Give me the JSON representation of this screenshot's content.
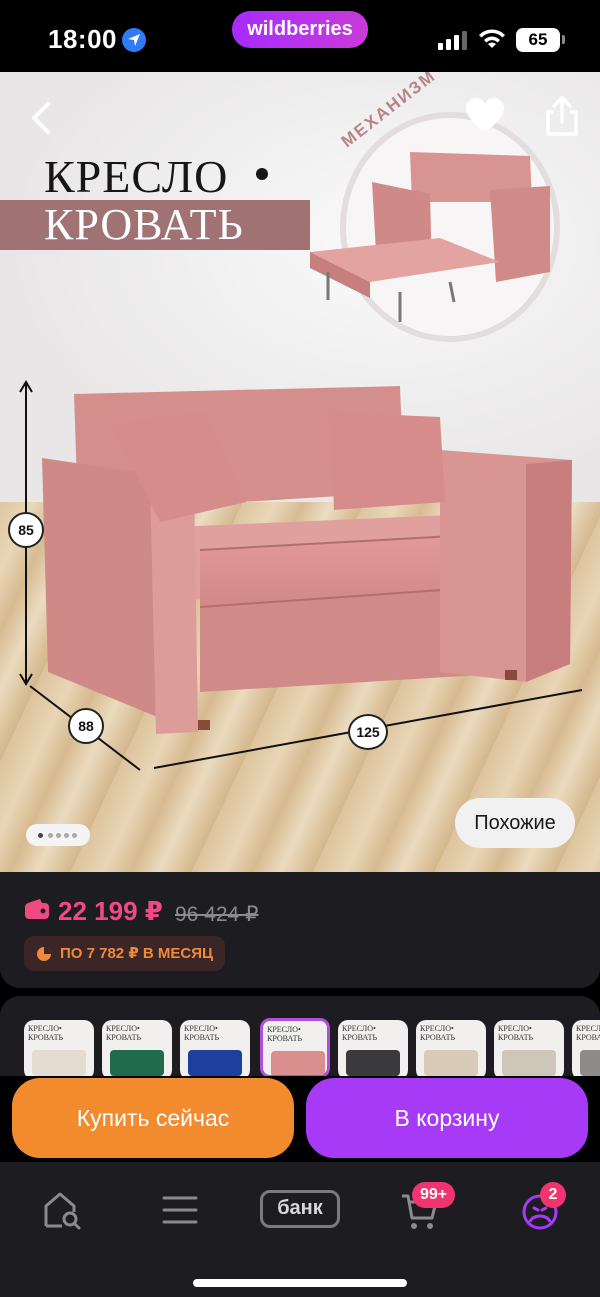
{
  "status_bar": {
    "time": "18:00",
    "brand": "wildberries",
    "battery": "65"
  },
  "gallery": {
    "promo_line1": "КРЕСЛО",
    "promo_line2": "КРОВАТЬ",
    "mechanism_label": "МЕХАНИЗМ «ЮНИОР»",
    "dimensions": {
      "height": "85",
      "depth": "88",
      "width": "125"
    },
    "similar_button": "Похожие",
    "colors": {
      "sofa": "#d98f8d",
      "sofa_dark": "#c5797a",
      "promo_band": "#a07274"
    }
  },
  "price": {
    "current": "22 199 ₽",
    "old": "96 424 ₽",
    "installment": "ПО 7 782 ₽ В МЕСЯЦ"
  },
  "variants": {
    "label": "КРЕСЛО• КРОВАТЬ",
    "items": [
      {
        "color": "#e4dcd0"
      },
      {
        "color": "#1f6b4a"
      },
      {
        "color": "#1f3f9c"
      },
      {
        "color": "#d98f8d"
      },
      {
        "color": "#3a3a3c"
      },
      {
        "color": "#d8cbb8"
      },
      {
        "color": "#cfc6ba"
      },
      {
        "color": "#8e8c8a"
      }
    ]
  },
  "actions": {
    "buy_now": "Купить сейчас",
    "add_to_cart": "В корзину"
  },
  "tabbar": {
    "bank_label": "банк",
    "cart_badge": "99+",
    "profile_badge": "2",
    "accent": "#a73af6",
    "badge_color": "#f0346f"
  }
}
